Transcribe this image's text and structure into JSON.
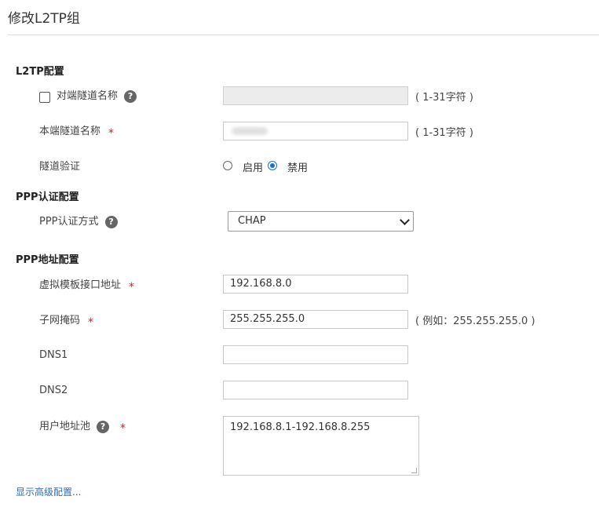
{
  "page": {
    "title": "修改L2TP组"
  },
  "sections": {
    "l2tp": "L2TP配置",
    "ppp_auth": "PPP认证配置",
    "ppp_addr": "PPP地址配置"
  },
  "fields": {
    "peer_tunnel_name": {
      "label": "对端隧道名称",
      "value": "",
      "hint": "( 1-31字符 )",
      "checked": false
    },
    "local_tunnel_name": {
      "label": "本端隧道名称",
      "hint": "( 1-31字符 )"
    },
    "tunnel_auth": {
      "label": "隧道验证",
      "option_enable": "启用",
      "option_disable": "禁用",
      "selected": "禁用"
    },
    "ppp_auth_method": {
      "label": "PPP认证方式",
      "value": "CHAP"
    },
    "virtual_template_ip": {
      "label": "虚拟模板接口地址",
      "value": "192.168.8.0"
    },
    "subnet_mask": {
      "label": "子网掩码",
      "value": "255.255.255.0",
      "hint": "( 例如：255.255.255.0 )"
    },
    "dns1": {
      "label": "DNS1",
      "value": ""
    },
    "dns2": {
      "label": "DNS2",
      "value": ""
    },
    "user_pool": {
      "label": "用户地址池",
      "value": "192.168.8.1-192.168.8.255"
    }
  },
  "icons": {
    "help": "?",
    "required": "*"
  },
  "advanced_link": "显示高级配置..."
}
